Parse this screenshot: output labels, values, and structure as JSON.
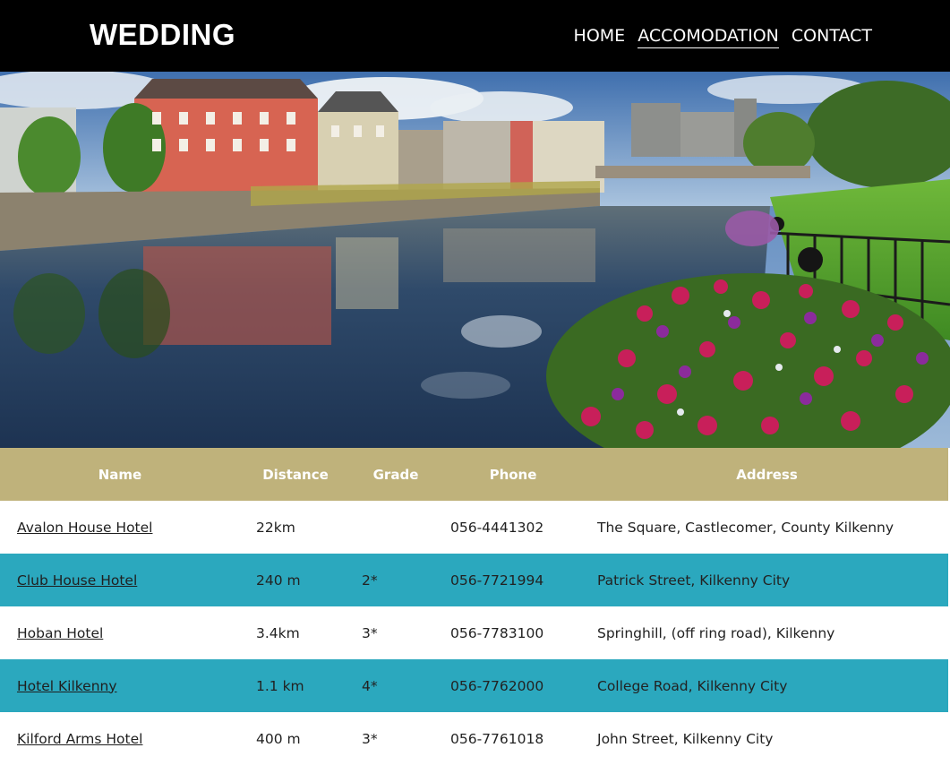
{
  "header": {
    "brand": "WEDDING",
    "nav": [
      {
        "label": "HOME",
        "active": false
      },
      {
        "label": "ACCOMODATION",
        "active": true
      },
      {
        "label": "CONTACT",
        "active": false
      }
    ]
  },
  "hero": {
    "icon": "riverside-town-photo"
  },
  "table": {
    "columns": [
      "Name",
      "Distance",
      "Grade",
      "Phone",
      "Address"
    ],
    "rows": [
      {
        "name": "Avalon House Hotel",
        "distance": "22km",
        "grade": "",
        "phone": "056-4441302",
        "address": "The Square, Castlecomer, County Kilkenny"
      },
      {
        "name": "Club House Hotel",
        "distance": "240 m",
        "grade": "2*",
        "phone": "056-7721994",
        "address": "Patrick Street, Kilkenny City"
      },
      {
        "name": "Hoban Hotel",
        "distance": "3.4km",
        "grade": "3*",
        "phone": "056-7783100",
        "address": "Springhill, (off ring road), Kilkenny"
      },
      {
        "name": "Hotel Kilkenny",
        "distance": "1.1 km",
        "grade": "4*",
        "phone": "056-7762000",
        "address": "College Road, Kilkenny City"
      },
      {
        "name": "Kilford Arms Hotel",
        "distance": "400 m",
        "grade": "3*",
        "phone": "056-7761018",
        "address": "John Street, Kilkenny City"
      }
    ]
  },
  "colors": {
    "header_bg": "#000000",
    "table_header_bg": "#bfb27b",
    "row_alt_bg": "#2ba8be"
  }
}
